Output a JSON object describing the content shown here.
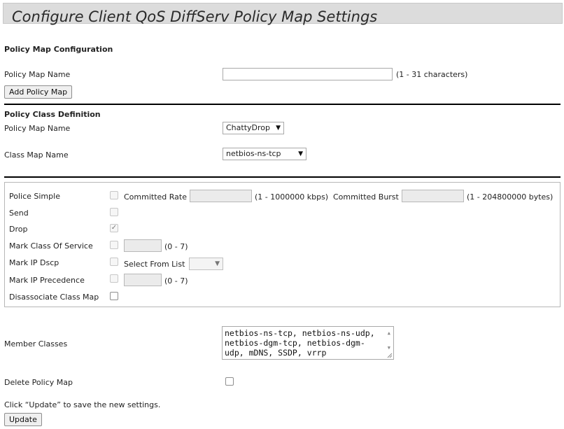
{
  "page": {
    "title": "Configure Client QoS DiffServ Policy Map Settings"
  },
  "policy_map_config": {
    "heading": "Policy Map Configuration",
    "name_label": "Policy Map Name",
    "name_value": "",
    "name_hint": "(1 - 31 characters)",
    "add_button": "Add Policy Map"
  },
  "policy_class_def": {
    "heading": "Policy Class Definition",
    "policy_map_label": "Policy Map Name",
    "policy_map_selected": "ChattyDrop",
    "class_map_label": "Class Map Name",
    "class_map_selected": "netbios-ns-tcp"
  },
  "actions": {
    "police_simple": {
      "label": "Police Simple",
      "checked": false,
      "committed_rate_label": "Committed Rate",
      "committed_rate_value": "",
      "committed_rate_hint": "(1 - 1000000 kbps)",
      "committed_burst_label": "Committed Burst",
      "committed_burst_value": "",
      "committed_burst_hint": "(1 - 204800000 bytes)"
    },
    "send": {
      "label": "Send",
      "checked": false
    },
    "drop": {
      "label": "Drop",
      "checked": true
    },
    "mark_cos": {
      "label": "Mark Class Of Service",
      "checked": false,
      "value": "",
      "hint": "(0 - 7)"
    },
    "mark_dscp": {
      "label": "Mark IP Dscp",
      "checked": false,
      "select_label": "Select From List",
      "selected": ""
    },
    "mark_precedence": {
      "label": "Mark IP Precedence",
      "checked": false,
      "value": "",
      "hint": "(0 - 7)"
    },
    "disassociate": {
      "label": "Disassociate Class Map",
      "checked": false
    }
  },
  "member_classes": {
    "label": "Member Classes",
    "value": "netbios-ns-tcp, netbios-ns-udp, netbios-dgm-tcp, netbios-dgm-udp, mDNS, SSDP, vrrp"
  },
  "delete_policy_map": {
    "label": "Delete Policy Map",
    "checked": false
  },
  "footer": {
    "note": "Click “Update” to save the new settings.",
    "update_button": "Update"
  }
}
